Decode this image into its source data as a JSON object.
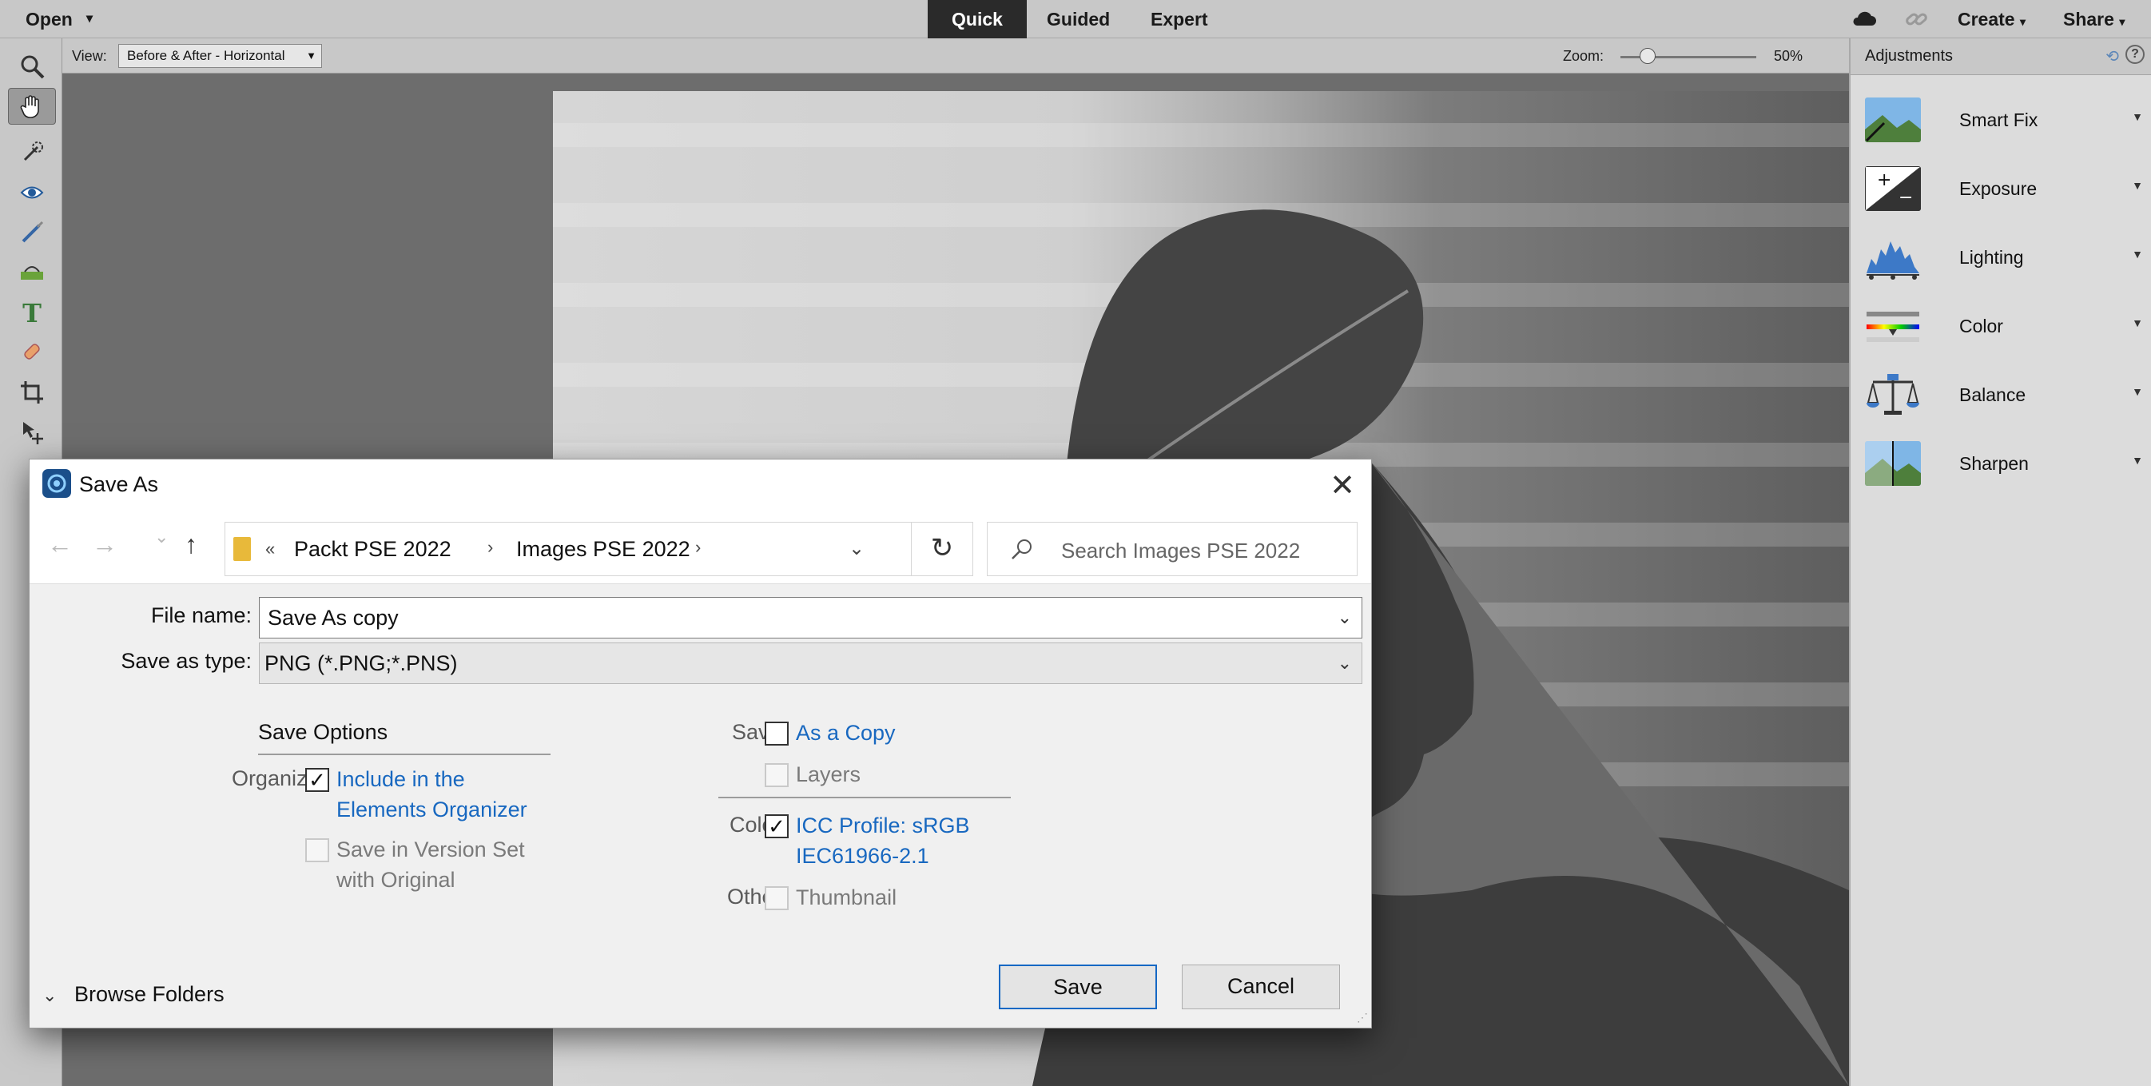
{
  "topbar": {
    "open_label": "Open",
    "caret": "▾",
    "modes": [
      "Quick",
      "Guided",
      "Expert"
    ],
    "active_mode": "Quick",
    "create_label": "Create",
    "share_label": "Share",
    "icons": [
      "cloud-icon",
      "link-icon"
    ]
  },
  "optbar": {
    "view_label": "View:",
    "view_value": "Before & After - Horizontal",
    "zoom_label": "Zoom:",
    "zoom_value": "50%",
    "zoom_level": 0.2
  },
  "tools": [
    "zoom-icon",
    "hand-icon",
    "quick-selection-icon",
    "red-eye-icon",
    "whiten-teeth-icon",
    "straighten-icon",
    "type-icon",
    "spot-healing-icon",
    "crop-icon",
    "move-icon"
  ],
  "panel": {
    "title": "Adjustments",
    "items": [
      {
        "label": "Smart Fix",
        "icon": "smart-fix-icon"
      },
      {
        "label": "Exposure",
        "icon": "exposure-icon"
      },
      {
        "label": "Lighting",
        "icon": "lighting-icon"
      },
      {
        "label": "Color",
        "icon": "color-icon"
      },
      {
        "label": "Balance",
        "icon": "balance-icon"
      },
      {
        "label": "Sharpen",
        "icon": "sharpen-icon"
      }
    ]
  },
  "dialog": {
    "title": "Save As",
    "close": "✕",
    "nav": {
      "back": "←",
      "forward": "→",
      "recent": "⌄",
      "up": "↑"
    },
    "address": {
      "laquo": "«",
      "crumbs": [
        "Packt PSE 2022",
        "Images PSE 2022"
      ],
      "sep": "›"
    },
    "refresh": "↻",
    "search_placeholder": "Search Images PSE 2022",
    "file_name_label": "File name:",
    "file_name_value": "Save As copy",
    "save_type_label": "Save as type:",
    "save_type_value": "PNG (*.PNG;*.PNS)",
    "save_options_title": "Save Options",
    "organize_label": "Organize:",
    "include_organizer": {
      "label_line1": "Include in the",
      "label_line2": "Elements Organizer",
      "checked": true
    },
    "version_set": {
      "label_line1": "Save in Version Set",
      "label_line2": "with Original",
      "checked": false
    },
    "save_label": "Save:",
    "as_a_copy": {
      "label": "As a Copy",
      "checked": false
    },
    "layers": {
      "label": "Layers",
      "checked": false
    },
    "color_label": "Color:",
    "icc_profile": {
      "label_line1": "ICC Profile:  sRGB",
      "label_line2": "IEC61966-2.1",
      "checked": true
    },
    "other_label": "Other:",
    "thumbnail": {
      "label": "Thumbnail",
      "checked": false
    },
    "browse_folders": "Browse Folders",
    "save_button": "Save",
    "cancel_button": "Cancel",
    "check": "✓"
  }
}
